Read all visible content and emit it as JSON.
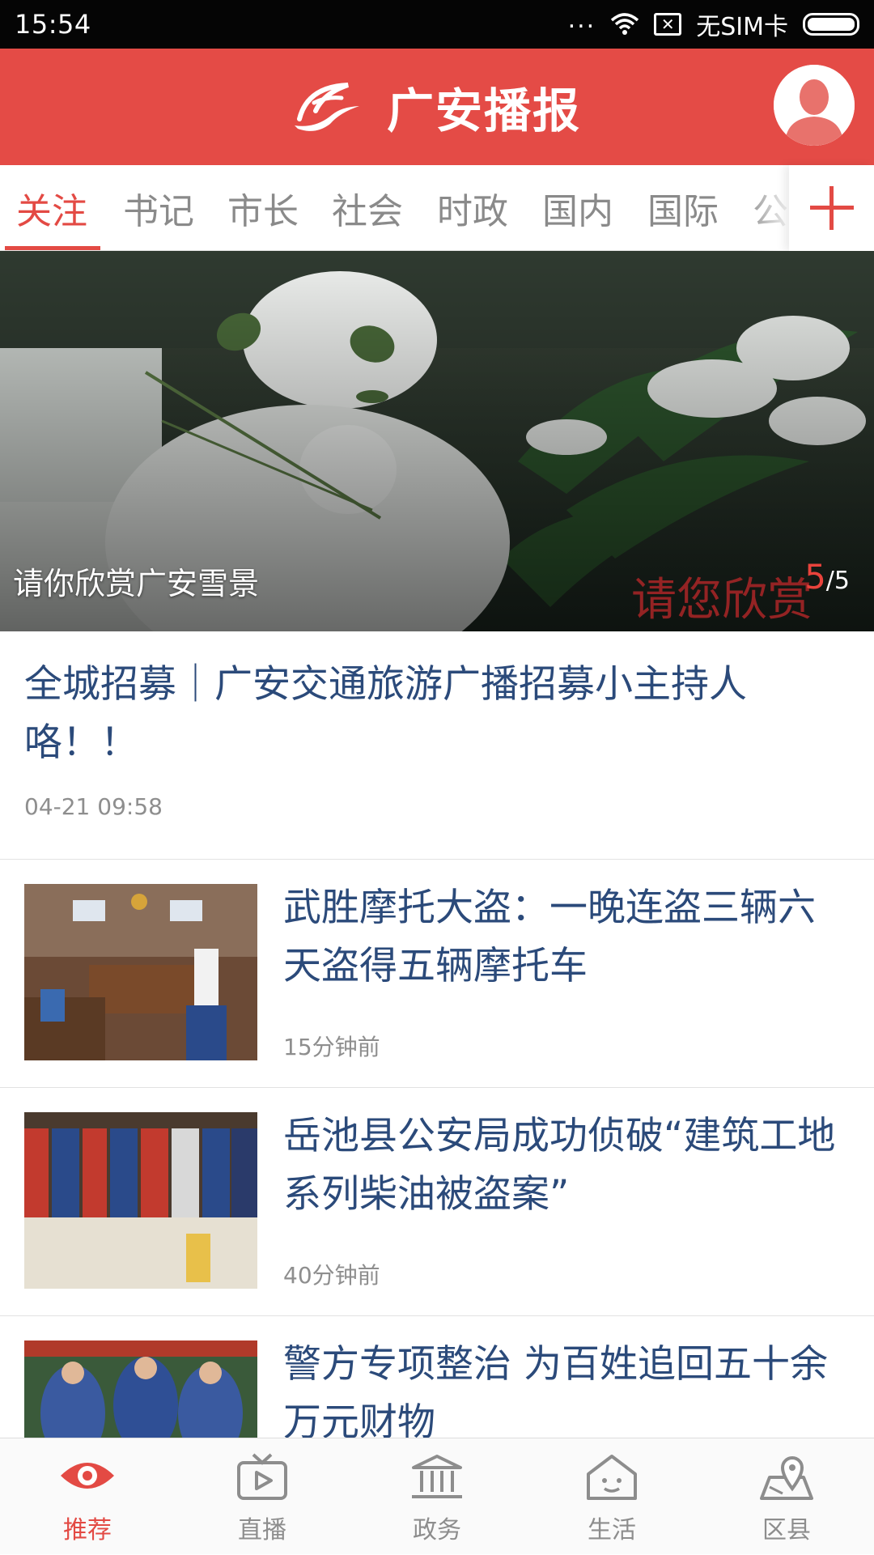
{
  "status_bar": {
    "time": "15:54",
    "dots": "...",
    "sim_text": "无SIM卡",
    "icons": [
      "wifi-icon",
      "no-sim-icon",
      "battery-icon"
    ],
    "battery_level": 1.0
  },
  "header": {
    "title": "广安播报",
    "logo_icon": "swoosh-logo",
    "avatar_icon": "user-avatar-icon",
    "color": "#e44b46"
  },
  "tabs": {
    "items": [
      "关注",
      "书记",
      "市长",
      "社会",
      "时政",
      "国内",
      "国际",
      "公"
    ],
    "active_index": 0,
    "add_icon": "plus-icon",
    "active_color": "#e34a44"
  },
  "banner": {
    "caption": "请你欣赏广安雪景",
    "watermark": "请您欣赏",
    "counter_current": "5",
    "counter_total": "/5"
  },
  "feature": {
    "title": "全城招募｜广安交通旅游广播招募小主持人咯！！",
    "time": "04-21 09:58"
  },
  "news": [
    {
      "title": "武胜摩托大盗：一晚连盗三辆六天盗得五辆摩托车",
      "time": "15分钟前"
    },
    {
      "title": "岳池县公安局成功侦破“建筑工地系列柴油被盗案”",
      "time": "40分钟前"
    },
    {
      "title": "警方专项整治 为百姓追回五十余万元财物",
      "time": ""
    }
  ],
  "bottom_nav": {
    "items": [
      {
        "label": "推荐",
        "icon": "eye-icon"
      },
      {
        "label": "直播",
        "icon": "tv-play-icon"
      },
      {
        "label": "政务",
        "icon": "government-building-icon"
      },
      {
        "label": "生活",
        "icon": "home-face-icon"
      },
      {
        "label": "区县",
        "icon": "map-pin-icon"
      }
    ],
    "active_index": 0
  }
}
